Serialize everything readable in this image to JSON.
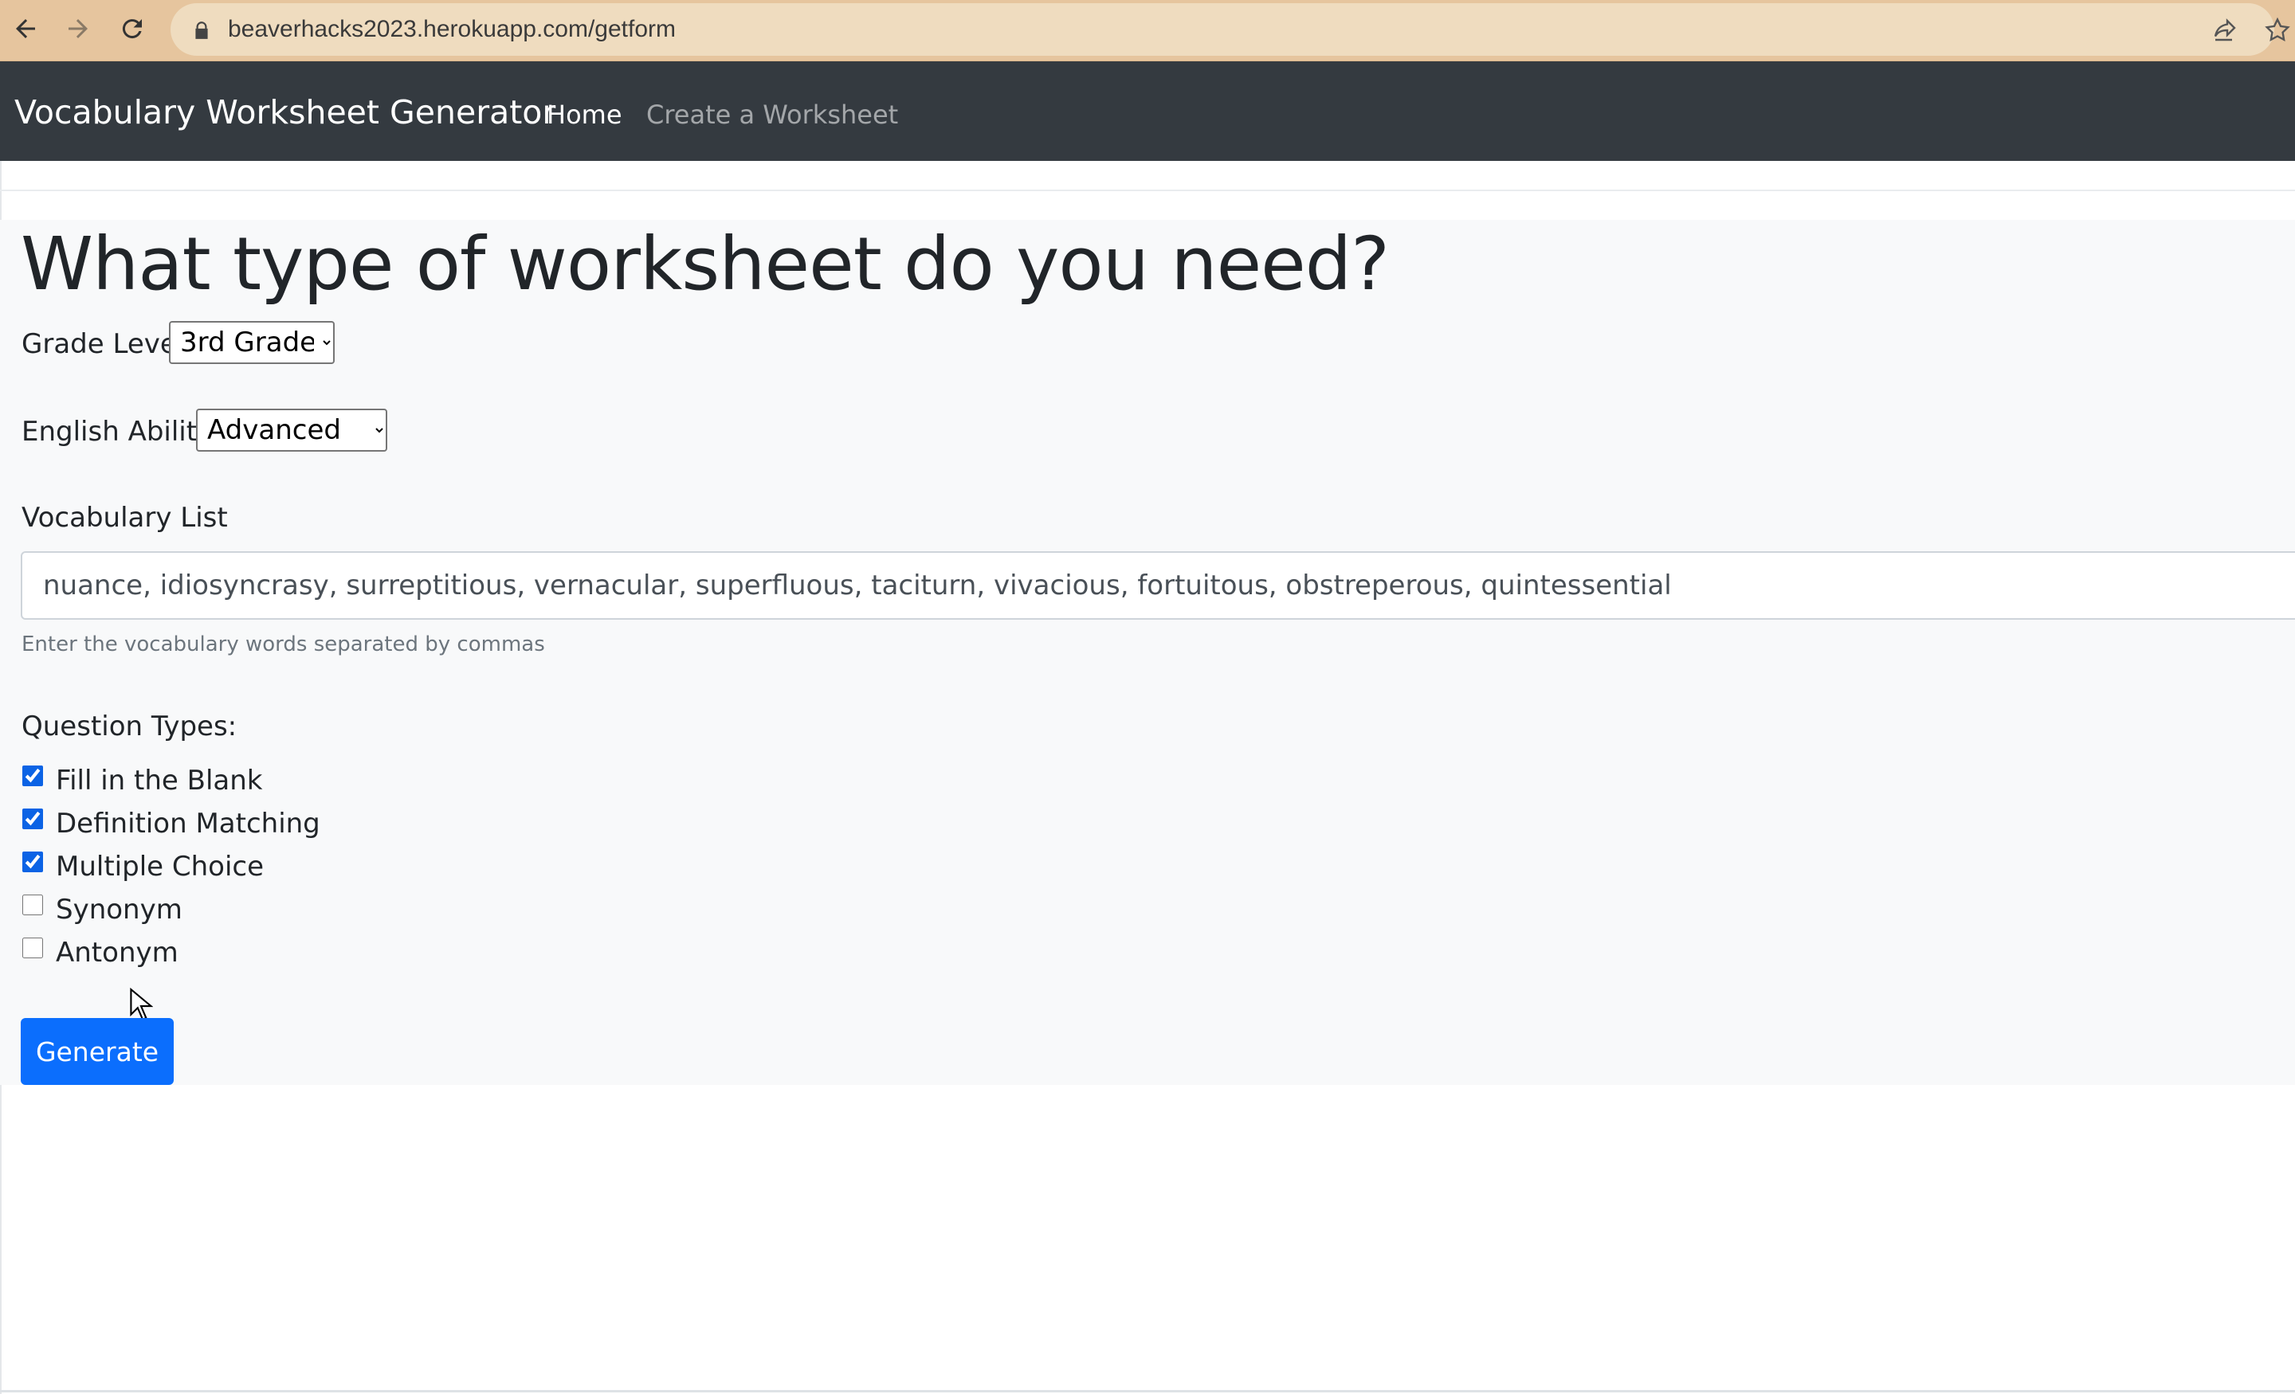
{
  "browser": {
    "url": "beaverhacks2023.herokuapp.com/getform"
  },
  "navbar": {
    "brand": "Vocabulary Worksheet Generator",
    "links": [
      {
        "label": "Home",
        "active": true
      },
      {
        "label": "Create a Worksheet",
        "active": false
      }
    ]
  },
  "form": {
    "title": "What type of worksheet do you need?",
    "grade_level": {
      "label": "Grade Level",
      "selected": "3rd Grade"
    },
    "english_ability": {
      "label": "English Ability",
      "selected": "Advanced"
    },
    "vocabulary": {
      "label": "Vocabulary List",
      "value": "nuance, idiosyncrasy, surreptitious, vernacular, superfluous, taciturn, vivacious, fortuitous, obstreperous, quintessential",
      "help": "Enter the vocabulary words separated by commas"
    },
    "question_types": {
      "label": "Question Types:",
      "options": [
        {
          "label": "Fill in the Blank",
          "checked": true
        },
        {
          "label": "Definition Matching",
          "checked": true
        },
        {
          "label": "Multiple Choice",
          "checked": true
        },
        {
          "label": "Synonym",
          "checked": false
        },
        {
          "label": "Antonym",
          "checked": false
        }
      ]
    },
    "submit_label": "Generate"
  },
  "colors": {
    "browser_bar": "#e6c59e",
    "navbar_bg": "#343a40",
    "primary": "#0b6efd"
  }
}
